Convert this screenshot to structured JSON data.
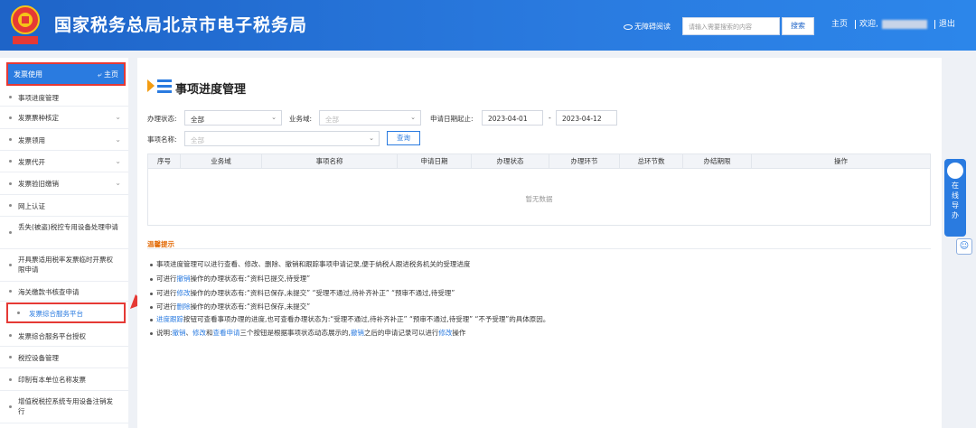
{
  "header": {
    "title": "国家税务总局北京市电子税务局",
    "emblem_text": "中国税务",
    "accessibility": "无障碍阅读",
    "search_placeholder": "请输入需要搜索的内容",
    "search_button": "搜索",
    "home_link": "主页",
    "welcome": "欢迎,",
    "logout": "退出"
  },
  "sidebar": {
    "head_label": "发票使用",
    "home_label": "主页",
    "items": [
      {
        "label": "事项进度管理"
      },
      {
        "label": "发票票种核定"
      },
      {
        "label": "发票领用"
      },
      {
        "label": "发票代开"
      },
      {
        "label": "发票验旧缴销"
      },
      {
        "label": "网上认证"
      },
      {
        "label": "丢失(被盗)税控专用设备处理申请"
      },
      {
        "label": "开具票适用税率发票临时开票权限申请"
      },
      {
        "label": "海关缴款书核查申请"
      },
      {
        "label": "发票综合服务平台"
      },
      {
        "label": "发票综合服务平台授权"
      },
      {
        "label": "税控设备管理"
      },
      {
        "label": "印制有本单位名称发票"
      },
      {
        "label": "增值税税控系统专用设备注销发行"
      }
    ]
  },
  "main": {
    "title": "事项进度管理",
    "filters": {
      "status_label": "办理状态:",
      "status_value": "全部",
      "domain_label": "业务域:",
      "domain_placeholder": "全部",
      "date_label": "申请日期起止:",
      "date_start": "2023-04-01",
      "date_sep": "-",
      "date_end": "2023-04-12",
      "name_label": "事项名称:",
      "name_placeholder": "全部",
      "query_button": "查询"
    },
    "table": {
      "columns": [
        "序号",
        "业务域",
        "事项名称",
        "申请日期",
        "办理状态",
        "办理环节",
        "总环节数",
        "办结期限",
        "操作"
      ],
      "empty_text": "暂无数据"
    },
    "tips": {
      "title": "温馨提示",
      "lines": [
        {
          "parts": [
            {
              "t": "事项进度管理可以进行查看、修改、删除、撤销和跟踪事项申请记录,便于纳税人跟进税务机关的受理进度",
              "link": false
            }
          ]
        },
        {
          "parts": [
            {
              "t": "可进行",
              "link": false
            },
            {
              "t": "撤销",
              "link": true
            },
            {
              "t": "操作的办理状态有:“资料已提交,待受理”",
              "link": false
            }
          ]
        },
        {
          "parts": [
            {
              "t": "可进行",
              "link": false
            },
            {
              "t": "修改",
              "link": true
            },
            {
              "t": "操作的办理状态有:“资料已保存,未提交”  “受理不通过,待补齐补正”  “预审不通过,待受理”",
              "link": false
            }
          ]
        },
        {
          "parts": [
            {
              "t": "可进行",
              "link": false
            },
            {
              "t": "删除",
              "link": true
            },
            {
              "t": "操作的办理状态有:“资料已保存,未提交”",
              "link": false
            }
          ]
        },
        {
          "parts": [
            {
              "t": "进度跟踪",
              "link": true
            },
            {
              "t": "按钮可查看事项办理的进度,也可查看办理状态为:“受理不通过,待补齐补正”  “预审不通过,待受理”  “不予受理”的具体原因。",
              "link": false
            }
          ]
        },
        {
          "parts": [
            {
              "t": "说明:",
              "link": false
            },
            {
              "t": "撤销",
              "link": true
            },
            {
              "t": "、",
              "link": false
            },
            {
              "t": "修改",
              "link": true
            },
            {
              "t": "和",
              "link": false
            },
            {
              "t": "查看申请",
              "link": true
            },
            {
              "t": "三个按钮是根据事项状态动态展示的,",
              "link": false
            },
            {
              "t": "撤销",
              "link": true
            },
            {
              "t": "之后的申请记录可以进行",
              "link": false
            },
            {
              "t": "修改",
              "link": true
            },
            {
              "t": "操作",
              "link": false
            }
          ]
        }
      ]
    }
  },
  "helper": {
    "label_chars": [
      "在",
      "线",
      "导",
      "办"
    ]
  },
  "colors": {
    "brand": "#2a7be0",
    "highlight_border": "#e53935",
    "tips_title": "#e36c09"
  }
}
